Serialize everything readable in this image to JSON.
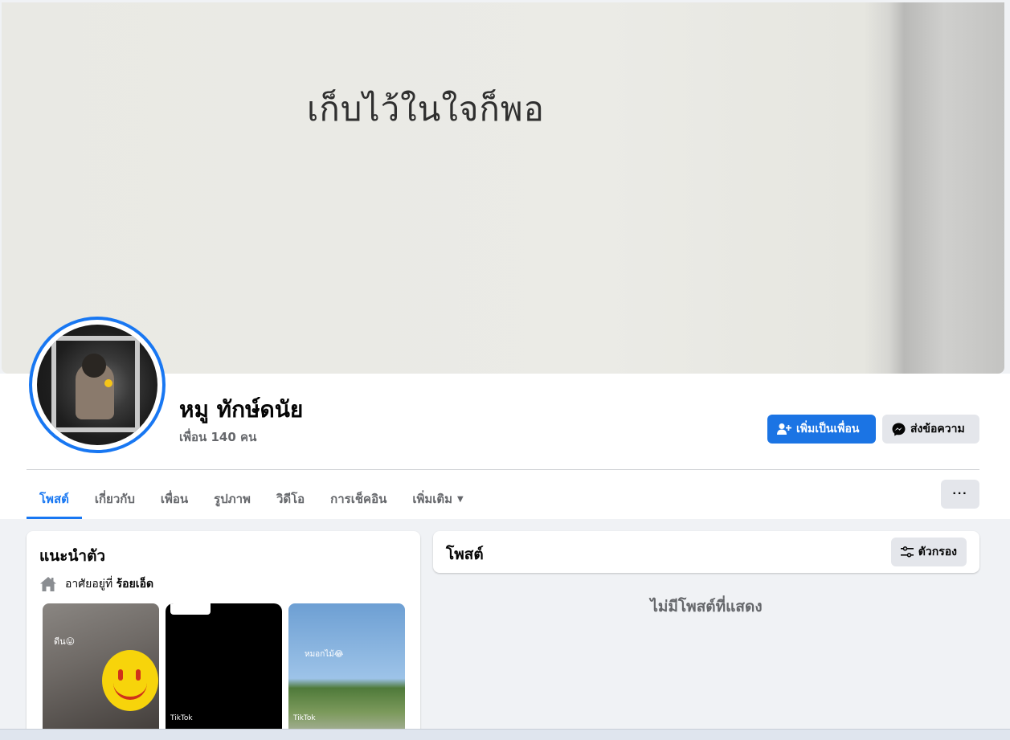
{
  "cover": {
    "text": "เก็บไว้ในใจก็พอ"
  },
  "profile": {
    "name": "หมู ทักษ์ดนัย",
    "friends": "เพื่อน 140 คน",
    "add_friend_label": "เพิ่มเป็นเพื่อน",
    "message_label": "ส่งข้อความ"
  },
  "tabs": [
    {
      "label": "โพสต์",
      "active": true
    },
    {
      "label": "เกี่ยวกับ"
    },
    {
      "label": "เพื่อน"
    },
    {
      "label": "รูปภาพ"
    },
    {
      "label": "วิดีโอ"
    },
    {
      "label": "การเช็คอิน"
    },
    {
      "label": "เพิ่มเติม"
    }
  ],
  "more_button": "···",
  "intro": {
    "title": "แนะนำตัว",
    "lives_in_prefix": "อาศัยอยู่ที่",
    "lives_in_place": "ร้อยเอ็ด",
    "thumbs": [
      {
        "caption": "ดีน😛",
        "badge": ""
      },
      {
        "caption": "",
        "badge": "TikTok"
      },
      {
        "caption": "หมอกไม้😂",
        "badge": "TikTok"
      }
    ]
  },
  "posts": {
    "title": "โพสต์",
    "filter_label": "ตัวกรอง",
    "empty_text": "ไม่มีโพสต์ที่แสดง"
  },
  "colors": {
    "accent": "#1877f2",
    "page_bg": "#f0f2f5",
    "secondary_button": "#e4e6eb",
    "muted_text": "#65676b"
  }
}
